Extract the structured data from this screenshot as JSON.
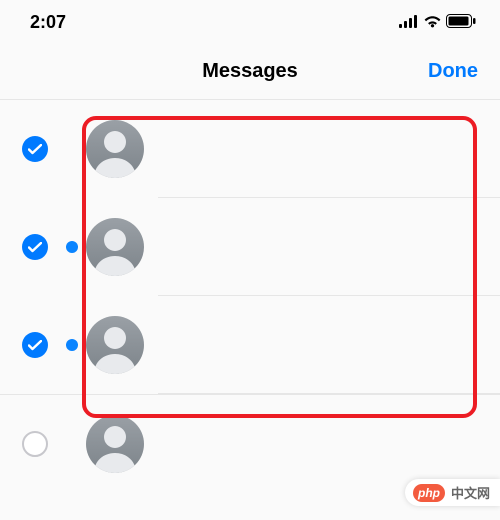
{
  "status_bar": {
    "time": "2:07"
  },
  "nav": {
    "title": "Messages",
    "done": "Done"
  },
  "colors": {
    "accent": "#007aff",
    "highlight_border": "#ec1c24",
    "avatar_gradient_top": "#9aa0a6",
    "avatar_gradient_bottom": "#7d848a"
  },
  "messages": [
    {
      "selected": true,
      "unread": false
    },
    {
      "selected": true,
      "unread": true
    },
    {
      "selected": true,
      "unread": true
    },
    {
      "selected": false,
      "unread": false
    }
  ],
  "watermark": {
    "logo_text": "php",
    "label": "中文网"
  }
}
